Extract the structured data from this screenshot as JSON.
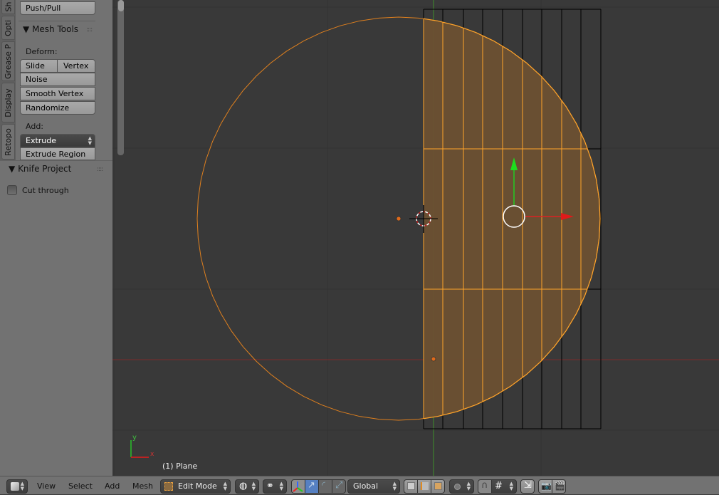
{
  "tool_shelf": {
    "tabs": [
      "Sh",
      "Opti",
      "Grease P",
      "Display",
      "Retopo"
    ],
    "push_pull": "Push/Pull",
    "mesh_tools": {
      "title": "Mesh Tools",
      "deform_label": "Deform:",
      "slide_edge": "Slide Ed",
      "vertex": "Vertex",
      "noise": "Noise",
      "smooth_vertex": "Smooth Vertex",
      "randomize": "Randomize",
      "add_label": "Add:",
      "extrude": "Extrude",
      "extrude_region": "Extrude Region"
    }
  },
  "knife_project": {
    "title": "Knife Project",
    "cut_through": "Cut through",
    "cut_through_checked": false
  },
  "viewport": {
    "object_label": "(1) Plane",
    "axis_x": "x",
    "axis_y": "y",
    "colors": {
      "background": "#393939",
      "selected_face": "#6b5031",
      "selected_edge": "#ffa42a",
      "wire": "#000000",
      "x_axis": "#9a2a2a",
      "y_axis": "#4e9a2a"
    }
  },
  "header": {
    "editor_type_icon": "cube-icon",
    "menus": [
      "View",
      "Select",
      "Add",
      "Mesh"
    ],
    "mode": "Edit Mode",
    "pivot_icon": "globe-icon",
    "shading_icon": "spheres-icon",
    "orientation": "Global",
    "proportional_icon": "circle-icon",
    "snap_icon": "magnet-icon"
  }
}
